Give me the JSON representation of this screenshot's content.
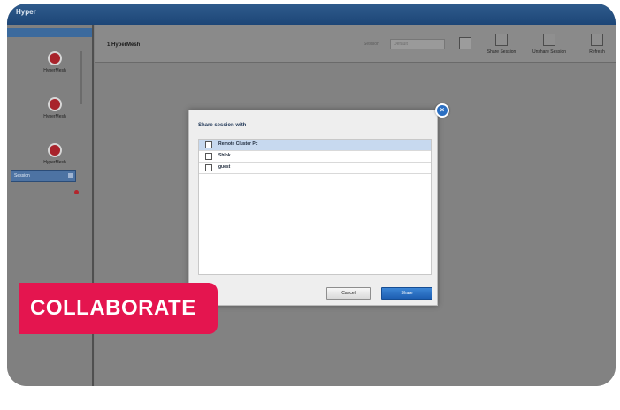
{
  "app": {
    "title": "Hyper",
    "window_right_text": ""
  },
  "sidebar": {
    "tools": [
      {
        "label": "HyperMesh",
        "icon": "hypermesh-icon"
      },
      {
        "label": "HyperMesh",
        "icon": "hypermesh-icon"
      },
      {
        "label": "HyperMesh",
        "icon": "hypermesh-icon"
      }
    ],
    "selector_value": "Session"
  },
  "toolbar": {
    "sheet_label": "1 HyperMesh",
    "field_label": "Session",
    "field_value": "Default",
    "buttons": [
      {
        "label": "Share Session",
        "icon": "share-session-icon"
      },
      {
        "label": "Unshare Session",
        "icon": "unshare-session-icon"
      },
      {
        "label": "Refresh",
        "icon": "refresh-icon"
      }
    ]
  },
  "dialog": {
    "title": "Share session with",
    "users": [
      {
        "name": "Remote Cluster Pc",
        "selected": true
      },
      {
        "name": "Shlok",
        "selected": false
      },
      {
        "name": "guest",
        "selected": false
      }
    ],
    "cancel_label": "Cancel",
    "share_label": "Share",
    "close_symbol": "×"
  },
  "banner": {
    "text": "COLLABORATE",
    "color": "#e4154f"
  }
}
